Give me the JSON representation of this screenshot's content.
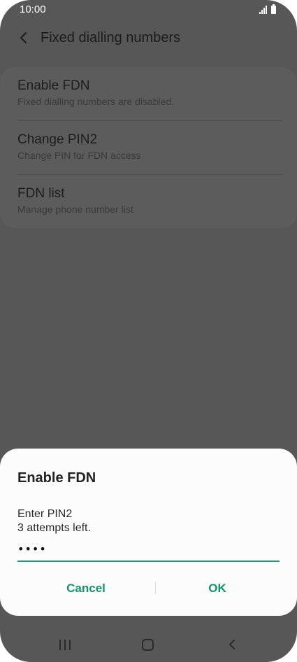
{
  "status_bar": {
    "time": "10:00",
    "icons": [
      "signal-icon",
      "battery-icon"
    ]
  },
  "header": {
    "title": "Fixed dialling numbers",
    "back_icon": "chevron-left-icon"
  },
  "settings": {
    "items": [
      {
        "title": "Enable FDN",
        "subtitle": "Fixed dialling numbers are disabled."
      },
      {
        "title": "Change PIN2",
        "subtitle": "Change PIN for FDN access"
      },
      {
        "title": "FDN list",
        "subtitle": "Manage phone number list"
      }
    ]
  },
  "dialog": {
    "title": "Enable FDN",
    "prompt_line1": "Enter PIN2",
    "prompt_line2": "3 attempts left.",
    "pin_value": "••••",
    "cancel_label": "Cancel",
    "ok_label": "OK"
  },
  "nav_bar": {
    "icons": [
      "recents-icon",
      "home-icon",
      "back-icon"
    ]
  },
  "colors": {
    "accent": "#14946a",
    "overlay": "#575757",
    "dialog_bg": "#fcfcfc"
  }
}
